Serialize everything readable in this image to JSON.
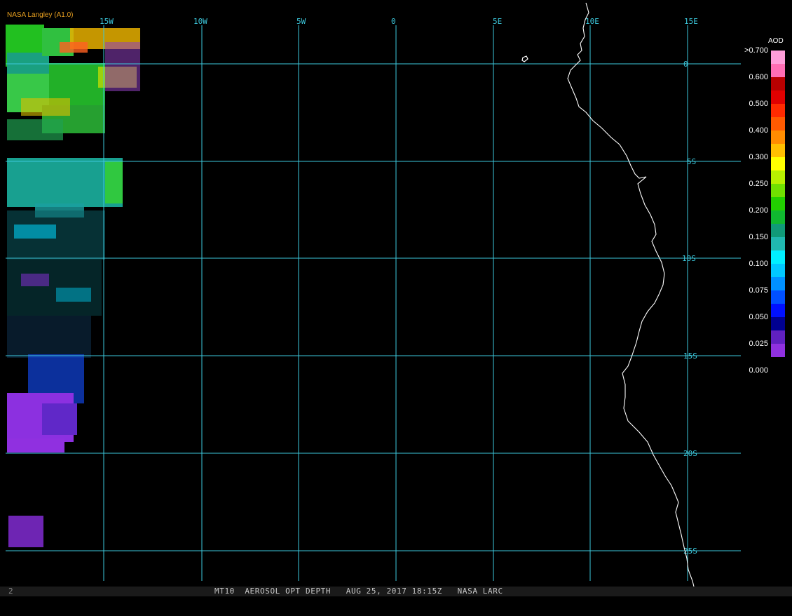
{
  "producer_label": "NASA Langley (A1.0)",
  "footer": {
    "text": "MT10  AEROSOL OPT DEPTH   AUG 25, 2017 18:15Z   NASA LARC",
    "left_mark": "2"
  },
  "grid": {
    "lon_labels": [
      "15W",
      "10W",
      "5W",
      "0",
      "5E",
      "10E",
      "15E"
    ],
    "lat_labels": [
      "0",
      "5S",
      "10S",
      "15S",
      "20S",
      "25S"
    ]
  },
  "legend": {
    "title": "AOD",
    "tick_labels": [
      ">0.700",
      "0.600",
      "0.500",
      "0.400",
      "0.300",
      "0.250",
      "0.200",
      "0.150",
      "0.100",
      "0.075",
      "0.050",
      "0.025",
      "0.000"
    ],
    "colors": [
      "#ff9ed9",
      "#ff6eb4",
      "#b80000",
      "#e00000",
      "#ff2a00",
      "#ff5a00",
      "#ff8c00",
      "#ffbf00",
      "#ffff00",
      "#b8f000",
      "#70e000",
      "#22d000",
      "#10b830",
      "#109a78",
      "#20b8b0",
      "#00f0ff",
      "#00c8ff",
      "#0090ff",
      "#0050ff",
      "#0010ff",
      "#000090",
      "#6020c0",
      "#9030e0"
    ]
  },
  "colors": {
    "grid": "#3cc8dc",
    "coast": "#ffffff",
    "producer": "#e8a020"
  }
}
